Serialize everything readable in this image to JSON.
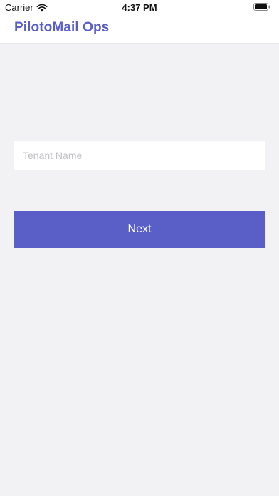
{
  "status_bar": {
    "carrier": "Carrier",
    "time": "4:37 PM",
    "icons": [
      "wifi-icon",
      "battery-icon"
    ]
  },
  "header": {
    "title": "PilotoMail Ops"
  },
  "form": {
    "tenant_placeholder": "Tenant Name",
    "tenant_value": "",
    "next_label": "Next"
  },
  "colors": {
    "accent": "#5a5fc8",
    "background": "#f2f2f4",
    "surface": "#ffffff",
    "placeholder": "#c2c2c6"
  }
}
